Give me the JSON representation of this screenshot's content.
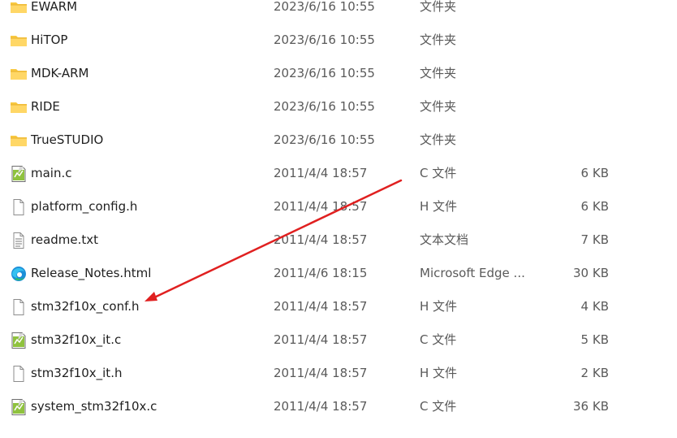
{
  "files": [
    {
      "name": "EWARM",
      "date": "2023/6/16 10:55",
      "type": "文件夹",
      "size": "",
      "icon": "folder-icon"
    },
    {
      "name": "HiTOP",
      "date": "2023/6/16 10:55",
      "type": "文件夹",
      "size": "",
      "icon": "folder-icon"
    },
    {
      "name": "MDK-ARM",
      "date": "2023/6/16 10:55",
      "type": "文件夹",
      "size": "",
      "icon": "folder-icon"
    },
    {
      "name": "RIDE",
      "date": "2023/6/16 10:55",
      "type": "文件夹",
      "size": "",
      "icon": "folder-icon"
    },
    {
      "name": "TrueSTUDIO",
      "date": "2023/6/16 10:55",
      "type": "文件夹",
      "size": "",
      "icon": "folder-icon"
    },
    {
      "name": "main.c",
      "date": "2011/4/4 18:57",
      "type": "C 文件",
      "size": "6 KB",
      "icon": "c-source-file-icon"
    },
    {
      "name": "platform_config.h",
      "date": "2011/4/4 18:57",
      "type": "H 文件",
      "size": "6 KB",
      "icon": "blank-file-icon"
    },
    {
      "name": "readme.txt",
      "date": "2011/4/4 18:57",
      "type": "文本文档",
      "size": "7 KB",
      "icon": "text-file-icon"
    },
    {
      "name": "Release_Notes.html",
      "date": "2011/4/6 18:15",
      "type": "Microsoft Edge ...",
      "size": "30 KB",
      "icon": "edge-html-file-icon"
    },
    {
      "name": "stm32f10x_conf.h",
      "date": "2011/4/4 18:57",
      "type": "H 文件",
      "size": "4 KB",
      "icon": "blank-file-icon"
    },
    {
      "name": "stm32f10x_it.c",
      "date": "2011/4/4 18:57",
      "type": "C 文件",
      "size": "5 KB",
      "icon": "c-source-file-icon"
    },
    {
      "name": "stm32f10x_it.h",
      "date": "2011/4/4 18:57",
      "type": "H 文件",
      "size": "2 KB",
      "icon": "blank-file-icon"
    },
    {
      "name": "system_stm32f10x.c",
      "date": "2011/4/4 18:57",
      "type": "C 文件",
      "size": "36 KB",
      "icon": "c-source-file-icon"
    }
  ],
  "annotation": {
    "arrow_color": "#e02020",
    "points_to": "stm32f10x_conf.h"
  }
}
